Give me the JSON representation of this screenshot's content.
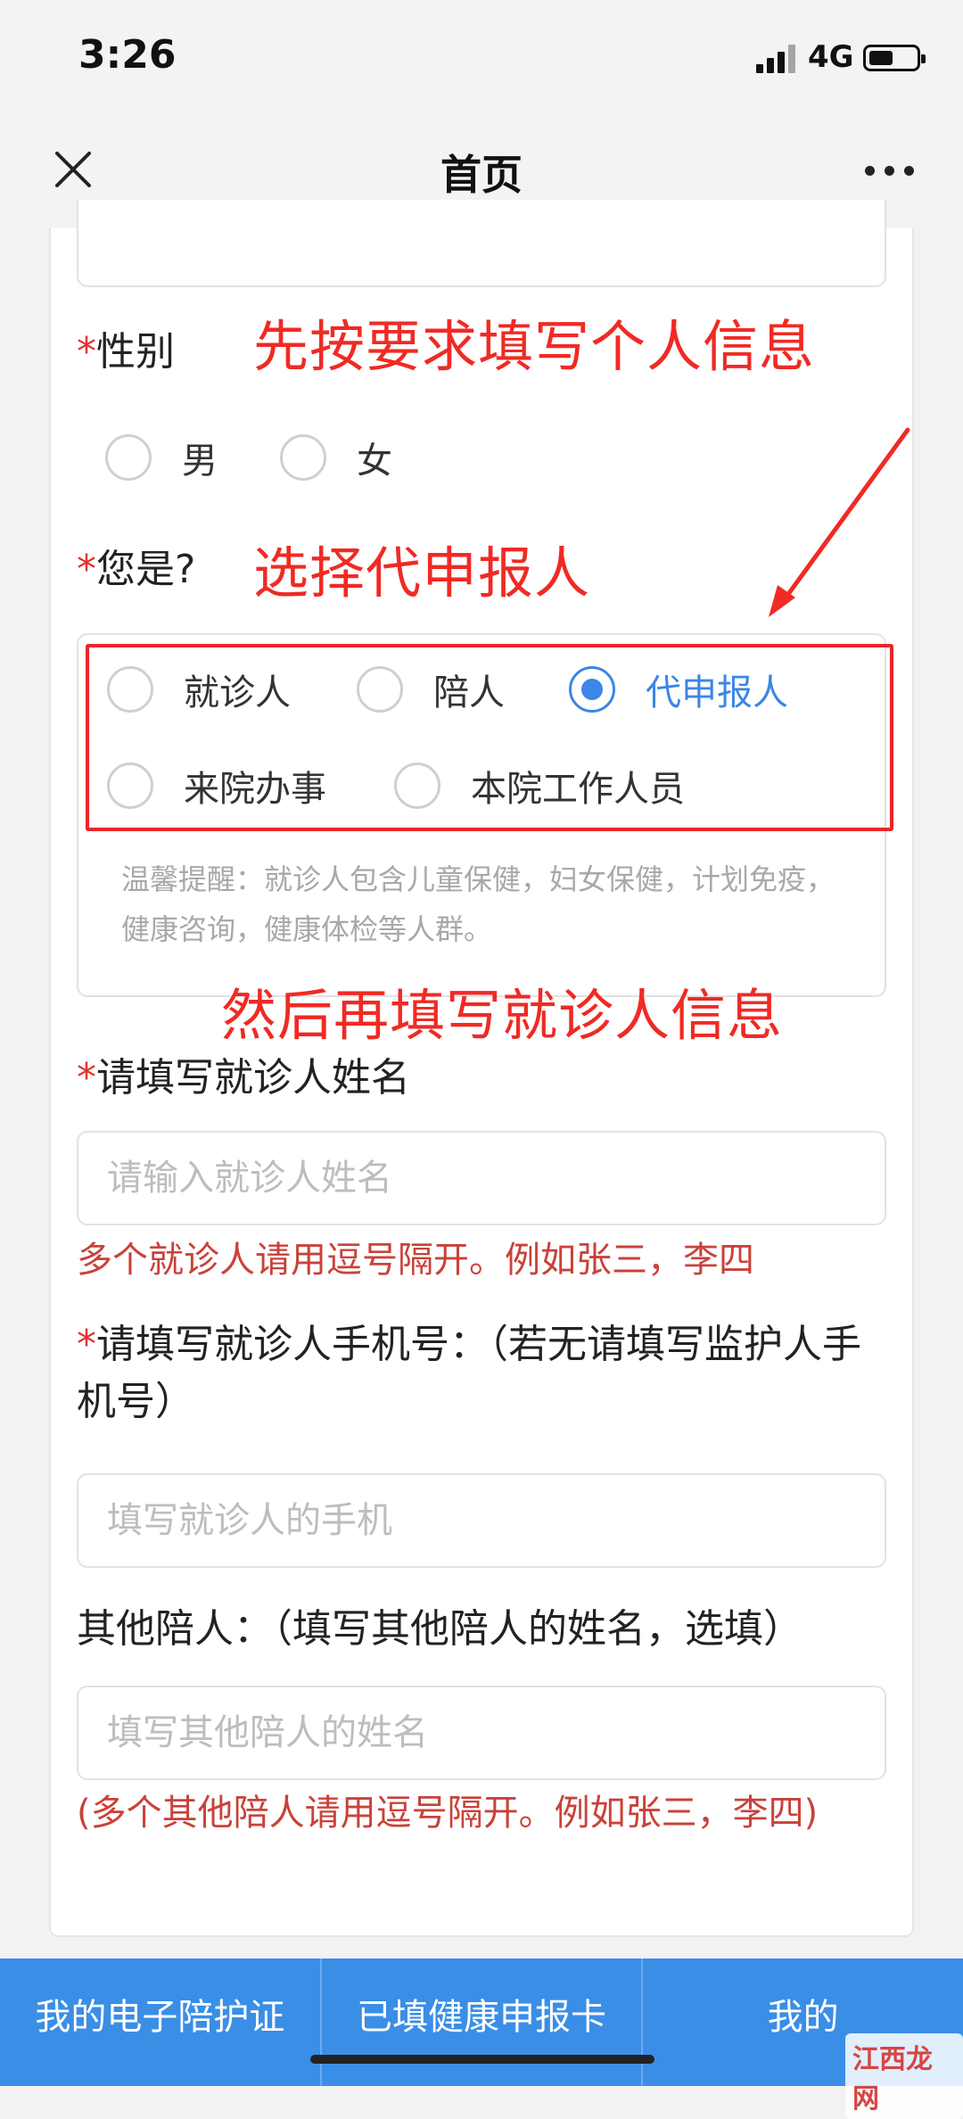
{
  "status_bar": {
    "time": "3:26",
    "network": "4G"
  },
  "nav": {
    "title": "首页"
  },
  "form": {
    "gender": {
      "required_mark": "*",
      "label": "性别",
      "options": [
        "男",
        "女"
      ]
    },
    "role": {
      "required_mark": "*",
      "label": "您是?",
      "options": [
        "就诊人",
        "陪人",
        "代申报人",
        "来院办事",
        "本院工作人员"
      ],
      "selected": "代申报人",
      "reminder": "温馨提醒：就诊人包含儿童保健，妇女保健，计划免疫，健康咨询，健康体检等人群。"
    },
    "patient_name": {
      "required_mark": "*",
      "label": "请填写就诊人姓名",
      "placeholder": "请输入就诊人姓名",
      "hint": "多个就诊人请用逗号隔开。例如张三，李四"
    },
    "patient_phone": {
      "required_mark": "*",
      "label": "请填写就诊人手机号：（若无请填写监护人手机号）",
      "placeholder": "填写就诊人的手机"
    },
    "companions": {
      "label": "其他陪人：（填写其他陪人的姓名，选填）",
      "placeholder": "填写其他陪人的姓名",
      "hint": "(多个其他陪人请用逗号隔开。例如张三，李四)"
    }
  },
  "annotations": {
    "fill_personal_info": "先按要求填写个人信息",
    "choose_agent": "选择代申报人",
    "then_fill_patient": "然后再填写就诊人信息",
    "color": "#f02a24"
  },
  "tabs": [
    "我的电子陪护证",
    "已填健康申报卡",
    "我的"
  ],
  "watermark": "江西龙网",
  "colors": {
    "accent": "#3b86e6",
    "tab_bar": "#3a8ee6",
    "required": "#e0322d"
  }
}
